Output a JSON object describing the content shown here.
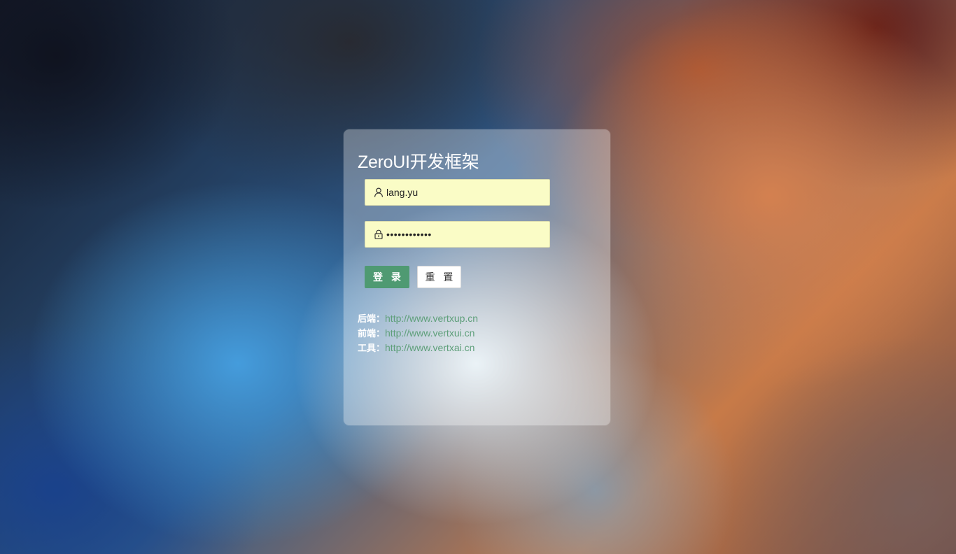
{
  "login": {
    "title": "ZeroUI开发框架",
    "username": {
      "value": "lang.yu",
      "icon": "user-icon"
    },
    "password": {
      "value": "••••••••••••",
      "icon": "lock-icon"
    },
    "buttons": {
      "login_label": "登 录",
      "reset_label": "重 置"
    },
    "links": [
      {
        "label": "后端：",
        "url": "http://www.vertxup.cn"
      },
      {
        "label": "前端：",
        "url": "http://www.vertxui.cn"
      },
      {
        "label": "工具：",
        "url": "http://www.vertxai.cn"
      }
    ]
  },
  "colors": {
    "primary": "#4f9a72",
    "link": "#5e9f7a",
    "input_autofill": "#fafcc6"
  }
}
